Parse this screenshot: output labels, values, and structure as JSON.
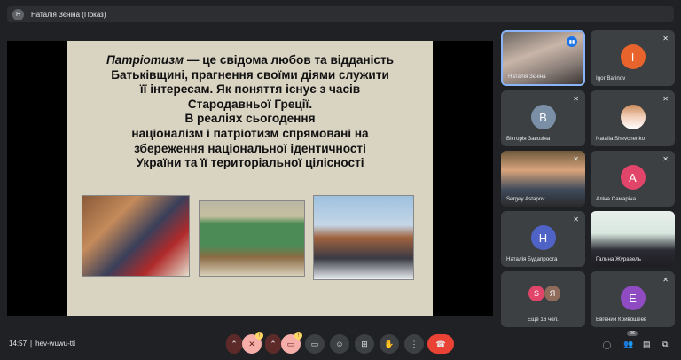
{
  "topbar": {
    "avatar_letter": "Н",
    "title": "Наталія Зєніна (Показ)"
  },
  "slide": {
    "term": "Патріотизм",
    "lines": [
      " — це свідома любов та відданість",
      "Батьківщині, прагнення своїми діями служити",
      "її інтересам. Як поняття існує з часів",
      "Стародавньої Греції.",
      "В реаліях сьогодення",
      "націоналізм і патріотизм спрямовані на",
      "збереження національної ідентичності",
      "України та її територіальної цілісності"
    ]
  },
  "participants": [
    {
      "name": "Наталія Зєніна",
      "letter": "",
      "color": "",
      "type": "video"
    },
    {
      "name": "Igor Barinov",
      "letter": "I",
      "color": "#e8642c"
    },
    {
      "name": "Вікторія Завозіна",
      "letter": "В",
      "color": "#7b8fa6"
    },
    {
      "name": "Natalia Shevchenko",
      "letter": "",
      "color": "",
      "type": "photo"
    },
    {
      "name": "Sergey Astapov",
      "letter": "",
      "color": "",
      "type": "video"
    },
    {
      "name": "Аліна Самаріна",
      "letter": "А",
      "color": "#e2456a"
    },
    {
      "name": "Наталія Будапроста",
      "letter": "Н",
      "color": "#4f63c7"
    },
    {
      "name": "Галина Журавель",
      "letter": "",
      "color": "",
      "type": "video"
    },
    {
      "name": "Ещё 16 чел.",
      "letter": "",
      "color": "",
      "type": "more"
    },
    {
      "name": "Евгений Кривошеев",
      "letter": "Е",
      "color": "#8e4bc2"
    }
  ],
  "more_avatars": [
    "S",
    "Я"
  ],
  "bottom": {
    "time": "14:57",
    "separator": "|",
    "meeting_code": "hev-wuwu-tti",
    "participant_count": "26"
  },
  "icons": {
    "mic_off": "mic-off-icon",
    "cam_off": "camera-off-icon",
    "captions": "captions-icon",
    "emoji": "emoji-icon",
    "present": "present-icon",
    "hand": "raise-hand-icon",
    "leave": "leave-call-icon",
    "info": "info-icon",
    "people": "people-icon",
    "chat": "chat-icon",
    "activities": "activities-icon"
  }
}
